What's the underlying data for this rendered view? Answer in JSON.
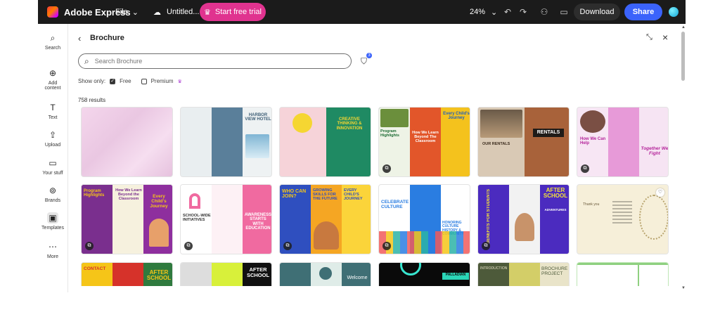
{
  "topbar": {
    "app_name": "Adobe Express",
    "file_label": "File",
    "doc_title": "Untitled...",
    "trial_label": "Start free trial",
    "zoom_level": "24%",
    "download_label": "Download",
    "share_label": "Share"
  },
  "rail": {
    "items": [
      {
        "label": "Search",
        "icon": "search-icon"
      },
      {
        "label": "Add content",
        "icon": "plus-circle-icon"
      },
      {
        "label": "Text",
        "icon": "text-icon"
      },
      {
        "label": "Upload",
        "icon": "upload-icon"
      },
      {
        "label": "Your stuff",
        "icon": "folder-icon"
      },
      {
        "label": "Brands",
        "icon": "brand-icon"
      },
      {
        "label": "Templates",
        "icon": "templates-icon"
      },
      {
        "label": "More",
        "icon": "more-icon"
      }
    ]
  },
  "panel": {
    "title": "Brochure",
    "search_placeholder": "Search Brochure",
    "filter_count": "3",
    "show_only_label": "Show only:",
    "free_label": "Free",
    "premium_label": "Premium",
    "results_label": "758 results"
  },
  "templates": {
    "t2_title": "HARBOR VIEW HOTEL",
    "t3_title": "CREATIVE THINKING & INNOVATION",
    "t4_left": "Program Highlights",
    "t4_mid": "How We Learn Beyond The Classroom",
    "t4_right": "Every Child's Journey",
    "t5_left": "OUR RENTALS",
    "t5_right": "RENTALS",
    "t6_left": "How We Can Help",
    "t6_right": "Together We Fight",
    "t7_left": "Program Highlights",
    "t7_mid": "How We Learn Beyond the Classroom",
    "t7_right": "Every Child's Journey",
    "t8_left": "SCHOOL-WIDE INITIATIVES",
    "t8_right": "AWARENESS STARTS WITH EDUCATION",
    "t9_left": "WHO CAN JOIN?",
    "t9_mid": "GROWING SKILLS FOR THE FUTURE",
    "t9_right": "EVERY CHILD'S JOURNEY",
    "t10_left": "CELEBRATE CULTURE",
    "t10_right": "HONORING CULTURE HISTORY & COMMUNITY",
    "t11_left": "BENEFITS FOR STUDENTS",
    "t11_right": "AFTER SCHOOL",
    "t11_sub": "ADVENTURES",
    "t12_title": "Thank you",
    "t13_left": "CONTACT",
    "t13_right": "AFTER SCHOOL",
    "t14_right": "AFTER SCHOOL",
    "t15_title": "Welcome",
    "t16_title": "PALLADIAN",
    "t17_left": "INTRODUCTION",
    "t17_right": "BROCHURE PROJECT"
  }
}
